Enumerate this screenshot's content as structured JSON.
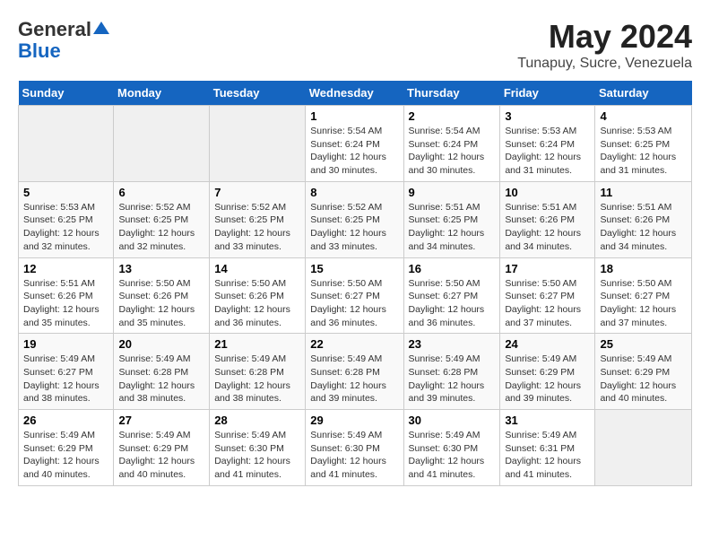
{
  "header": {
    "logo_line1": "General",
    "logo_line2": "Blue",
    "title": "May 2024",
    "subtitle": "Tunapuy, Sucre, Venezuela"
  },
  "days_of_week": [
    "Sunday",
    "Monday",
    "Tuesday",
    "Wednesday",
    "Thursday",
    "Friday",
    "Saturday"
  ],
  "weeks": [
    [
      {
        "day": "",
        "info": ""
      },
      {
        "day": "",
        "info": ""
      },
      {
        "day": "",
        "info": ""
      },
      {
        "day": "1",
        "info": "Sunrise: 5:54 AM\nSunset: 6:24 PM\nDaylight: 12 hours\nand 30 minutes."
      },
      {
        "day": "2",
        "info": "Sunrise: 5:54 AM\nSunset: 6:24 PM\nDaylight: 12 hours\nand 30 minutes."
      },
      {
        "day": "3",
        "info": "Sunrise: 5:53 AM\nSunset: 6:24 PM\nDaylight: 12 hours\nand 31 minutes."
      },
      {
        "day": "4",
        "info": "Sunrise: 5:53 AM\nSunset: 6:25 PM\nDaylight: 12 hours\nand 31 minutes."
      }
    ],
    [
      {
        "day": "5",
        "info": "Sunrise: 5:53 AM\nSunset: 6:25 PM\nDaylight: 12 hours\nand 32 minutes."
      },
      {
        "day": "6",
        "info": "Sunrise: 5:52 AM\nSunset: 6:25 PM\nDaylight: 12 hours\nand 32 minutes."
      },
      {
        "day": "7",
        "info": "Sunrise: 5:52 AM\nSunset: 6:25 PM\nDaylight: 12 hours\nand 33 minutes."
      },
      {
        "day": "8",
        "info": "Sunrise: 5:52 AM\nSunset: 6:25 PM\nDaylight: 12 hours\nand 33 minutes."
      },
      {
        "day": "9",
        "info": "Sunrise: 5:51 AM\nSunset: 6:25 PM\nDaylight: 12 hours\nand 34 minutes."
      },
      {
        "day": "10",
        "info": "Sunrise: 5:51 AM\nSunset: 6:26 PM\nDaylight: 12 hours\nand 34 minutes."
      },
      {
        "day": "11",
        "info": "Sunrise: 5:51 AM\nSunset: 6:26 PM\nDaylight: 12 hours\nand 34 minutes."
      }
    ],
    [
      {
        "day": "12",
        "info": "Sunrise: 5:51 AM\nSunset: 6:26 PM\nDaylight: 12 hours\nand 35 minutes."
      },
      {
        "day": "13",
        "info": "Sunrise: 5:50 AM\nSunset: 6:26 PM\nDaylight: 12 hours\nand 35 minutes."
      },
      {
        "day": "14",
        "info": "Sunrise: 5:50 AM\nSunset: 6:26 PM\nDaylight: 12 hours\nand 36 minutes."
      },
      {
        "day": "15",
        "info": "Sunrise: 5:50 AM\nSunset: 6:27 PM\nDaylight: 12 hours\nand 36 minutes."
      },
      {
        "day": "16",
        "info": "Sunrise: 5:50 AM\nSunset: 6:27 PM\nDaylight: 12 hours\nand 36 minutes."
      },
      {
        "day": "17",
        "info": "Sunrise: 5:50 AM\nSunset: 6:27 PM\nDaylight: 12 hours\nand 37 minutes."
      },
      {
        "day": "18",
        "info": "Sunrise: 5:50 AM\nSunset: 6:27 PM\nDaylight: 12 hours\nand 37 minutes."
      }
    ],
    [
      {
        "day": "19",
        "info": "Sunrise: 5:49 AM\nSunset: 6:27 PM\nDaylight: 12 hours\nand 38 minutes."
      },
      {
        "day": "20",
        "info": "Sunrise: 5:49 AM\nSunset: 6:28 PM\nDaylight: 12 hours\nand 38 minutes."
      },
      {
        "day": "21",
        "info": "Sunrise: 5:49 AM\nSunset: 6:28 PM\nDaylight: 12 hours\nand 38 minutes."
      },
      {
        "day": "22",
        "info": "Sunrise: 5:49 AM\nSunset: 6:28 PM\nDaylight: 12 hours\nand 39 minutes."
      },
      {
        "day": "23",
        "info": "Sunrise: 5:49 AM\nSunset: 6:28 PM\nDaylight: 12 hours\nand 39 minutes."
      },
      {
        "day": "24",
        "info": "Sunrise: 5:49 AM\nSunset: 6:29 PM\nDaylight: 12 hours\nand 39 minutes."
      },
      {
        "day": "25",
        "info": "Sunrise: 5:49 AM\nSunset: 6:29 PM\nDaylight: 12 hours\nand 40 minutes."
      }
    ],
    [
      {
        "day": "26",
        "info": "Sunrise: 5:49 AM\nSunset: 6:29 PM\nDaylight: 12 hours\nand 40 minutes."
      },
      {
        "day": "27",
        "info": "Sunrise: 5:49 AM\nSunset: 6:29 PM\nDaylight: 12 hours\nand 40 minutes."
      },
      {
        "day": "28",
        "info": "Sunrise: 5:49 AM\nSunset: 6:30 PM\nDaylight: 12 hours\nand 41 minutes."
      },
      {
        "day": "29",
        "info": "Sunrise: 5:49 AM\nSunset: 6:30 PM\nDaylight: 12 hours\nand 41 minutes."
      },
      {
        "day": "30",
        "info": "Sunrise: 5:49 AM\nSunset: 6:30 PM\nDaylight: 12 hours\nand 41 minutes."
      },
      {
        "day": "31",
        "info": "Sunrise: 5:49 AM\nSunset: 6:31 PM\nDaylight: 12 hours\nand 41 minutes."
      },
      {
        "day": "",
        "info": ""
      }
    ]
  ]
}
